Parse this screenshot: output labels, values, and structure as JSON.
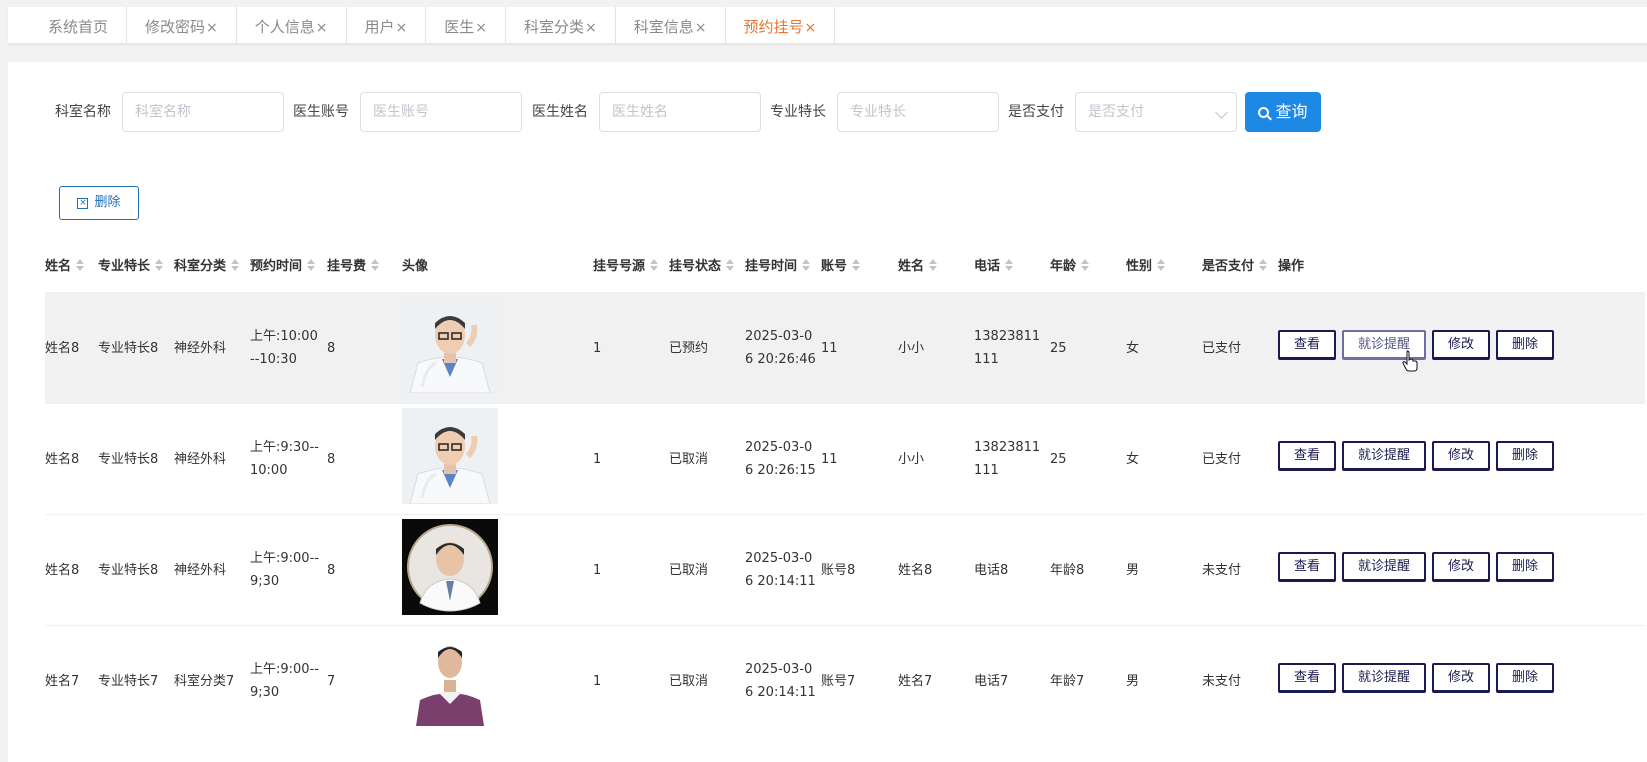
{
  "tabs": [
    {
      "label": "系统首页",
      "closable": false
    },
    {
      "label": "修改密码",
      "closable": true
    },
    {
      "label": "个人信息",
      "closable": true
    },
    {
      "label": "用户",
      "closable": true
    },
    {
      "label": "医生",
      "closable": true
    },
    {
      "label": "科室分类",
      "closable": true
    },
    {
      "label": "科室信息",
      "closable": true
    },
    {
      "label": "预约挂号",
      "closable": true,
      "active": true
    }
  ],
  "close_glyph": "×",
  "search": {
    "fields": [
      {
        "label": "科室名称",
        "placeholder": "科室名称"
      },
      {
        "label": "医生账号",
        "placeholder": "医生账号"
      },
      {
        "label": "医生姓名",
        "placeholder": "医生姓名"
      },
      {
        "label": "专业特长",
        "placeholder": "专业特长"
      }
    ],
    "select": {
      "label": "是否支付",
      "placeholder": "是否支付"
    },
    "query_label": "查询"
  },
  "toolbar": {
    "delete_label": "删除"
  },
  "table": {
    "columns": [
      "姓名",
      "专业特长",
      "科室分类",
      "预约时间",
      "挂号费",
      "头像",
      "挂号号源",
      "挂号状态",
      "挂号时间",
      "账号",
      "姓名",
      "电话",
      "年龄",
      "性别",
      "是否支付",
      "操作"
    ],
    "actions": [
      "查看",
      "就诊提醒",
      "修改",
      "删除"
    ],
    "rows": [
      {
        "doc_name": "姓名8",
        "specialty": "专业特长8",
        "dept": "神经外科",
        "time": "上午:10:00--10:30",
        "fee": "8",
        "source": "1",
        "status": "已预约",
        "reg_time": "2025-03-06 20:26:46",
        "account": "11",
        "name": "小小",
        "phone": "13823811111",
        "age": "25",
        "gender": "女",
        "paid": "已支付",
        "avatar": "doctor-glasses"
      },
      {
        "doc_name": "姓名8",
        "specialty": "专业特长8",
        "dept": "神经外科",
        "time": "上午:9:30--10:00",
        "fee": "8",
        "source": "1",
        "status": "已取消",
        "reg_time": "2025-03-06 20:26:15",
        "account": "11",
        "name": "小小",
        "phone": "13823811111",
        "age": "25",
        "gender": "女",
        "paid": "已支付",
        "avatar": "doctor-glasses"
      },
      {
        "doc_name": "姓名8",
        "specialty": "专业特长8",
        "dept": "神经外科",
        "time": "上午:9:00--9;30",
        "fee": "8",
        "source": "1",
        "status": "已取消",
        "reg_time": "2025-03-06 20:14:11",
        "account": "账号8",
        "name": "姓名8",
        "phone": "电话8",
        "age": "年龄8",
        "gender": "男",
        "paid": "未支付",
        "avatar": "doctor-round"
      },
      {
        "doc_name": "姓名7",
        "specialty": "专业特长7",
        "dept": "科室分类7",
        "time": "上午:9:00--9;30",
        "fee": "7",
        "source": "1",
        "status": "已取消",
        "reg_time": "2025-03-06 20:14:11",
        "account": "账号7",
        "name": "姓名7",
        "phone": "电话7",
        "age": "年龄7",
        "gender": "男",
        "paid": "未支付",
        "avatar": "man-sweater"
      }
    ]
  }
}
